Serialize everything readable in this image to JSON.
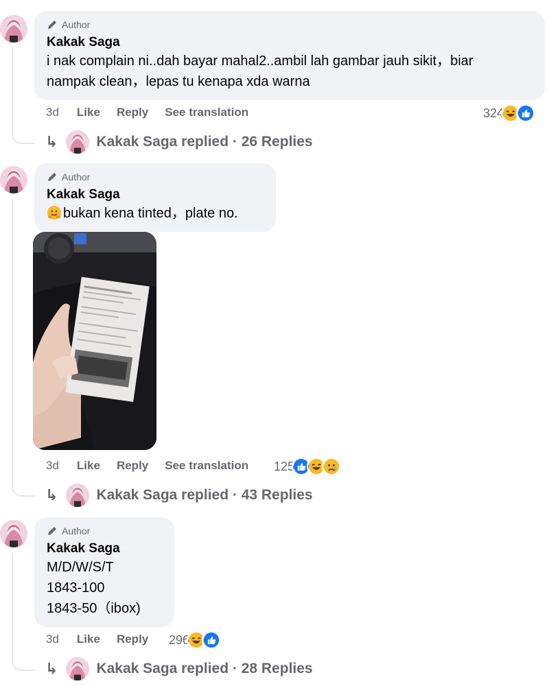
{
  "comments": [
    {
      "badge": "Author",
      "name": "Kakak Saga",
      "lines": [
        "i nak complain ni..dah bayar mahal2..ambil lah gambar jauh sikit，biar",
        "nampak clean，lepas tu kenapa xda warna"
      ],
      "time": "3d",
      "like": "Like",
      "reply": "Reply",
      "translate": "See translation",
      "reaction_count": "324",
      "reactions": [
        "laugh",
        "like"
      ],
      "replies_text": "Kakak Saga replied · 26 Replies"
    },
    {
      "badge": "Author",
      "name": "Kakak Saga",
      "lines": [
        "bukan kena tinted，plate no."
      ],
      "time": "3d",
      "like": "Like",
      "reply": "Reply",
      "translate": "See translation",
      "reaction_count": "125",
      "reactions": [
        "like",
        "laugh",
        "sad"
      ],
      "replies_text": "Kakak Saga replied · 43 Replies"
    },
    {
      "badge": "Author",
      "name": "Kakak Saga",
      "lines": [
        "M/D/W/S/T",
        "1843-100",
        "1843-50（ibox)"
      ],
      "time": "3d",
      "like": "Like",
      "reply": "Reply",
      "reaction_count": "296",
      "reactions": [
        "laugh",
        "like"
      ],
      "replies_text": "Kakak Saga replied · 28 Replies"
    }
  ],
  "colors": {
    "bubble": "#f0f2f5",
    "meta": "#65676b",
    "like_blue": "#1877f2",
    "laugh_yellow": "#f7b928"
  }
}
